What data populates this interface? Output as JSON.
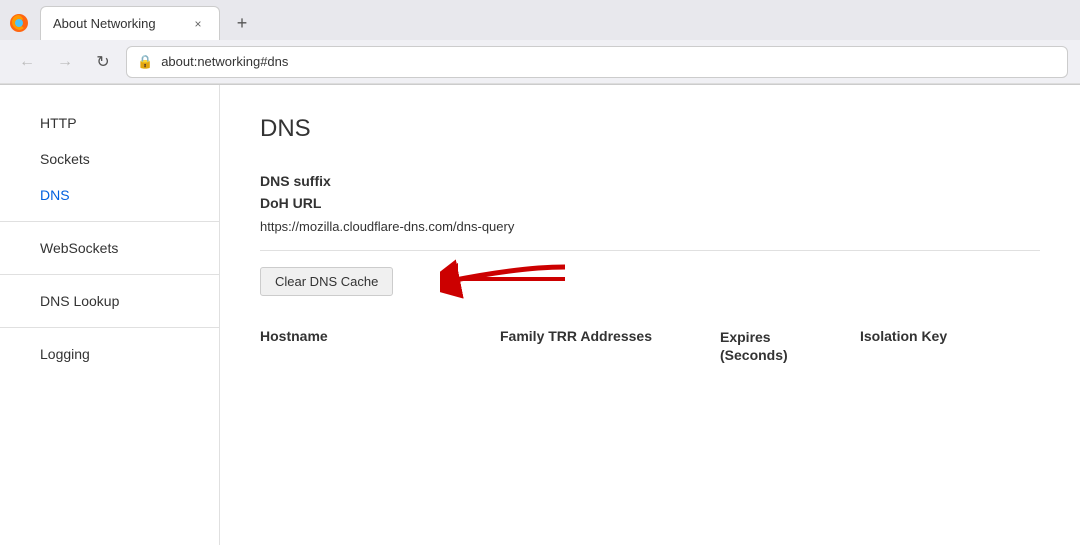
{
  "browser": {
    "tab": {
      "title": "About Networking",
      "close_label": "×"
    },
    "new_tab_label": "+",
    "nav": {
      "back_label": "←",
      "forward_label": "→",
      "reload_label": "↻",
      "address": "about:networking#dns"
    }
  },
  "sidebar": {
    "items": [
      {
        "id": "http",
        "label": "HTTP",
        "active": false
      },
      {
        "id": "sockets",
        "label": "Sockets",
        "active": false
      },
      {
        "id": "dns",
        "label": "DNS",
        "active": true
      },
      {
        "id": "websockets",
        "label": "WebSockets",
        "active": false
      },
      {
        "id": "dns-lookup",
        "label": "DNS Lookup",
        "active": false
      },
      {
        "id": "logging",
        "label": "Logging",
        "active": false
      }
    ]
  },
  "main": {
    "page_title": "DNS",
    "fields": [
      {
        "label": "DNS suffix"
      },
      {
        "label": "DoH URL"
      }
    ],
    "doh_url": "https://mozilla.cloudflare-dns.com/dns-query",
    "clear_btn_label": "Clear DNS Cache",
    "table_headers": {
      "hostname": "Hostname",
      "family_trr": "Family TRR Addresses",
      "expires": "Expires\n(Seconds)",
      "isolation_key": "Isolation Key"
    }
  }
}
